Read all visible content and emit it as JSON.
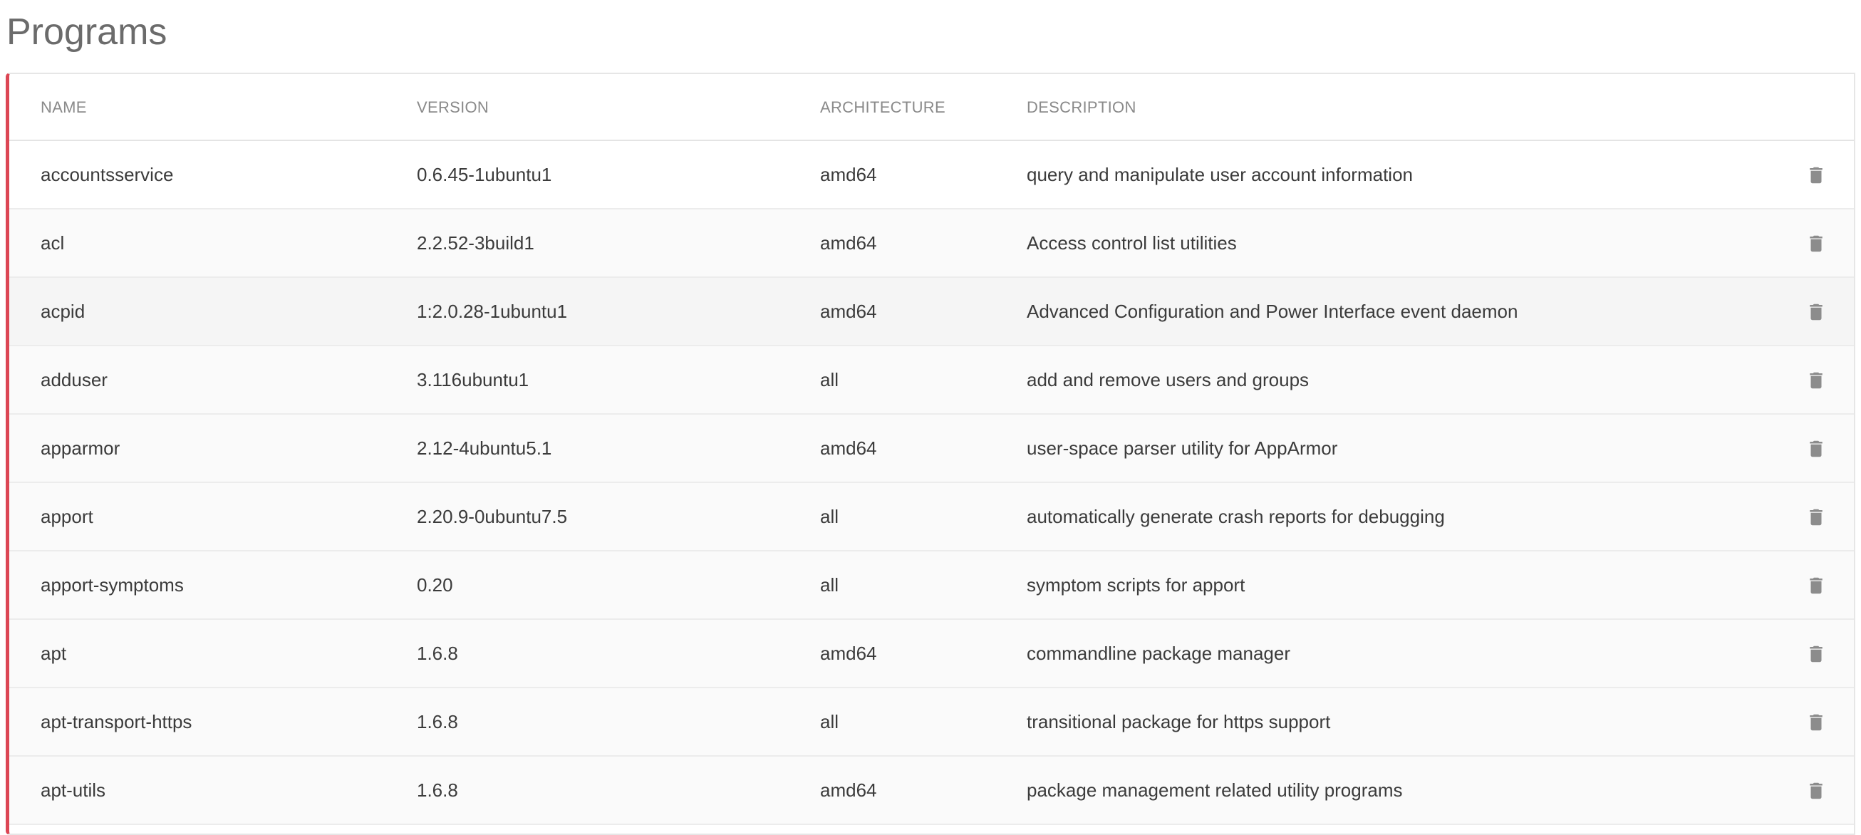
{
  "page": {
    "title": "Programs"
  },
  "table": {
    "columns": {
      "name": "NAME",
      "version": "VERSION",
      "architecture": "ARCHITECTURE",
      "description": "DESCRIPTION"
    },
    "rows": [
      {
        "name": "accountsservice",
        "version": "0.6.45-1ubuntu1",
        "architecture": "amd64",
        "description": "query and manipulate user account information"
      },
      {
        "name": "acl",
        "version": "2.2.52-3build1",
        "architecture": "amd64",
        "description": "Access control list utilities"
      },
      {
        "name": "acpid",
        "version": "1:2.0.28-1ubuntu1",
        "architecture": "amd64",
        "description": "Advanced Configuration and Power Interface event daemon"
      },
      {
        "name": "adduser",
        "version": "3.116ubuntu1",
        "architecture": "all",
        "description": "add and remove users and groups"
      },
      {
        "name": "apparmor",
        "version": "2.12-4ubuntu5.1",
        "architecture": "amd64",
        "description": "user-space parser utility for AppArmor"
      },
      {
        "name": "apport",
        "version": "2.20.9-0ubuntu7.5",
        "architecture": "all",
        "description": "automatically generate crash reports for debugging"
      },
      {
        "name": "apport-symptoms",
        "version": "0.20",
        "architecture": "all",
        "description": "symptom scripts for apport"
      },
      {
        "name": "apt",
        "version": "1.6.8",
        "architecture": "amd64",
        "description": "commandline package manager"
      },
      {
        "name": "apt-transport-https",
        "version": "1.6.8",
        "architecture": "all",
        "description": "transitional package for https support"
      },
      {
        "name": "apt-utils",
        "version": "1.6.8",
        "architecture": "amd64",
        "description": "package management related utility programs"
      }
    ],
    "row_action_icon": "trash-icon"
  },
  "colors": {
    "accent": "#dc4654",
    "icon": "#8c8c8c",
    "text": "#3b3b3b",
    "header_text": "#8a8a8a"
  }
}
